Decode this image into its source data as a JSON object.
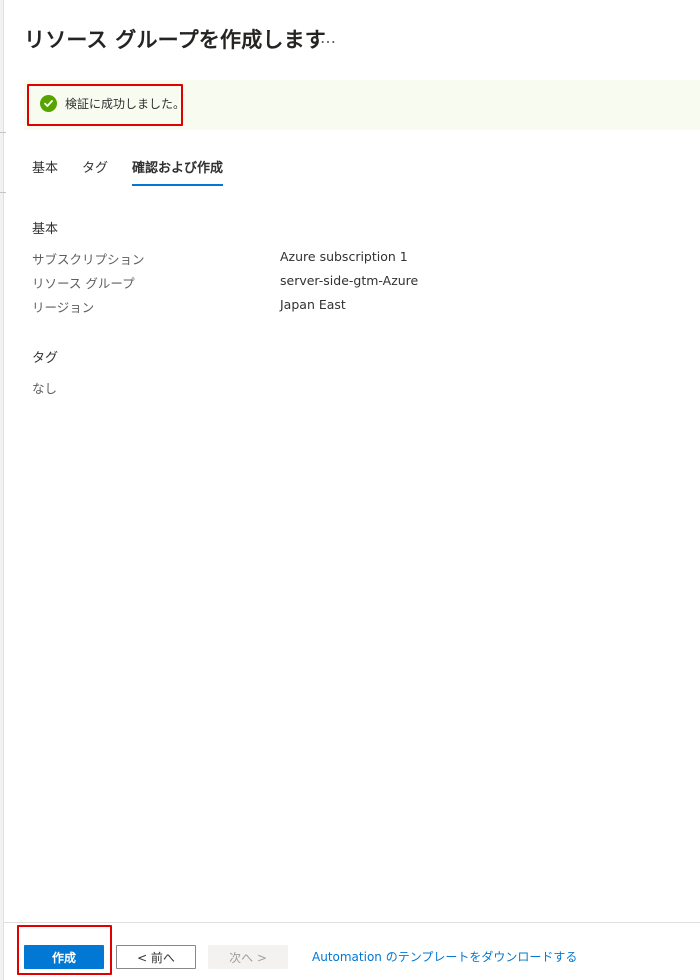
{
  "blade": {
    "title": "リソース グループを作成します",
    "more": "…"
  },
  "banner": {
    "text": "検証に成功しました。",
    "status_color": "#57a300",
    "icon": "check-circle-icon"
  },
  "tabs": [
    {
      "label": "基本",
      "active": false
    },
    {
      "label": "タグ",
      "active": false
    },
    {
      "label": "確認および作成",
      "active": true
    }
  ],
  "review": {
    "basics": {
      "heading": "基本",
      "rows": [
        {
          "key": "サブスクリプション",
          "value": "Azure subscription 1"
        },
        {
          "key": "リソース グループ",
          "value": "server-side-gtm-Azure"
        },
        {
          "key": "リージョン",
          "value": "Japan East"
        }
      ]
    },
    "tags": {
      "heading": "タグ",
      "value": "なし"
    }
  },
  "footer": {
    "create_label": "作成",
    "prev_label": "< 前へ",
    "next_label": "次へ >",
    "download_link": "Automation のテンプレートをダウンロードする"
  },
  "colors": {
    "accent": "#0078d4",
    "highlight": "#e00000"
  }
}
